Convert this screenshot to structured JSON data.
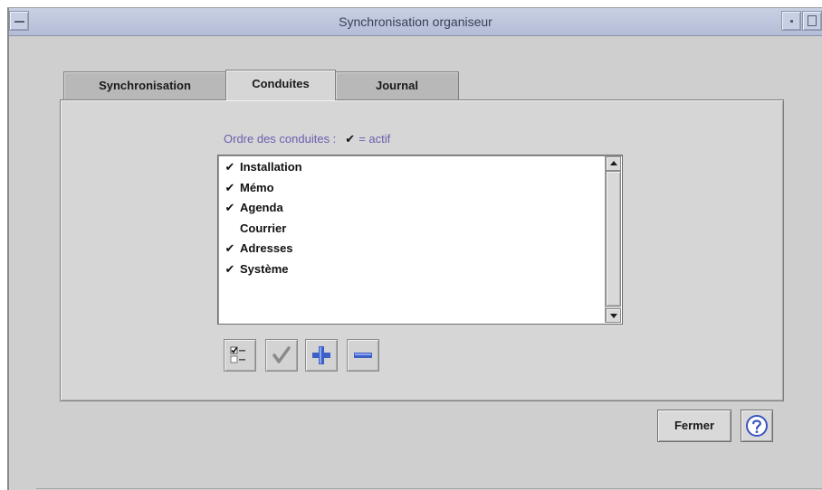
{
  "window": {
    "title": "Synchronisation organiseur"
  },
  "tabs": [
    {
      "label": "Synchronisation",
      "active": false
    },
    {
      "label": "Conduites",
      "active": true
    },
    {
      "label": "Journal",
      "active": false
    }
  ],
  "conduits": {
    "order_label": "Ordre des conduites :",
    "check_glyph": "✔",
    "legend": "= actif",
    "items": [
      {
        "label": "Installation",
        "active": true
      },
      {
        "label": "Mémo",
        "active": true
      },
      {
        "label": "Agenda",
        "active": true
      },
      {
        "label": "Courrier",
        "active": false
      },
      {
        "label": "Adresses",
        "active": true
      },
      {
        "label": "Système",
        "active": true
      }
    ]
  },
  "toolbar": {
    "icons": [
      "checklist-icon",
      "checkmark-icon",
      "plus-icon",
      "minus-icon"
    ]
  },
  "footer": {
    "close_label": "Fermer",
    "help_icon": "help-question-icon"
  },
  "colors": {
    "titlebar": "#b4bdd6",
    "label_accent": "#6a5fb0",
    "icon_blue": "#3c5fc8"
  }
}
